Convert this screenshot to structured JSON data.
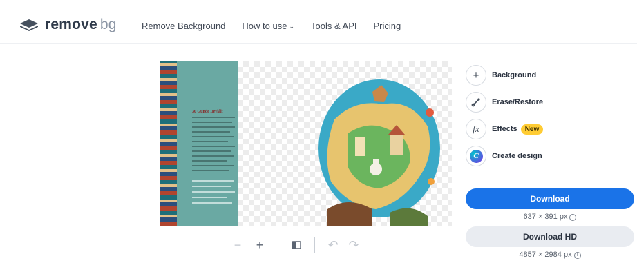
{
  "brand": {
    "logo_bold": "remove",
    "logo_light": "bg",
    "logo_icon": "stacked-layers-icon",
    "text_color": "#2f3a4a"
  },
  "nav": {
    "items": [
      {
        "label": "Remove Background"
      },
      {
        "label": "How to use",
        "has_dropdown": true
      },
      {
        "label": "Tools & API"
      },
      {
        "label": "Pricing"
      }
    ]
  },
  "preview": {
    "book_title": "30 Günde Devlâlt",
    "checker_color": "#ececec",
    "book_color": "#6aa9a3"
  },
  "controls": {
    "zoom_out_icon": "minus-icon",
    "zoom_in_icon": "plus-icon",
    "compare_icon": "compare-icon",
    "undo_icon": "undo-icon",
    "redo_icon": "redo-icon"
  },
  "tools": [
    {
      "label": "Background",
      "icon": "plus-icon"
    },
    {
      "label": "Erase/Restore",
      "icon": "brush-icon"
    },
    {
      "label": "Effects",
      "icon": "fx-icon",
      "badge": "New"
    },
    {
      "label": "Create design",
      "icon": "canva-icon"
    }
  ],
  "download": {
    "button_label": "Download",
    "resolution": "637 × 391 px",
    "hd_button_label": "Download HD",
    "hd_resolution": "4857 × 2984 px",
    "primary_color": "#1a73e8",
    "badge_color": "#ffcc33"
  }
}
